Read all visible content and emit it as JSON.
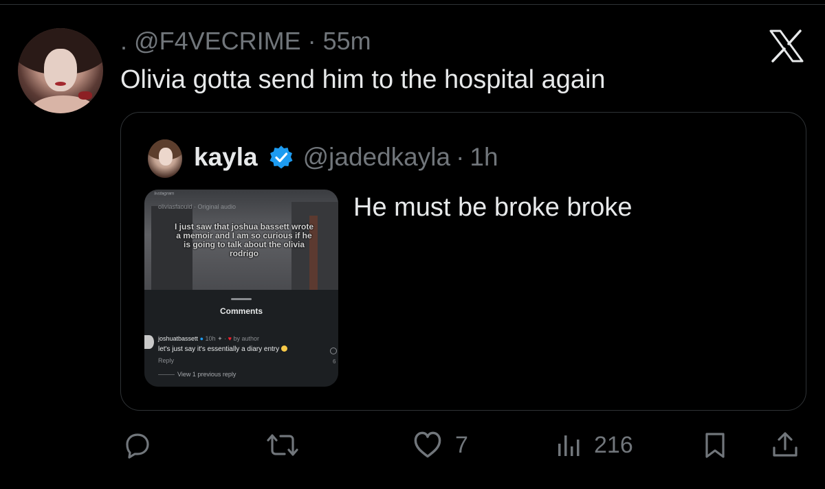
{
  "tweet": {
    "display_name": ".",
    "handle": "@F4VECRIME",
    "separator": "·",
    "time": "55m",
    "text": "Olivia gotta send him to the hospital again"
  },
  "quoted": {
    "name": "kayla",
    "handle": "@jadedkayla",
    "separator": "·",
    "time": "1h",
    "text": "He must be broke broke",
    "media": {
      "header_line": "ᴵⁿˢᵗᵃᵍʳᵃᵐ",
      "sub_header": "oliviasfaouid · Original audio",
      "overlay_text": "I just saw that joshua bassett wrote a memoir and I am so curious if he is going to talk about the olivia rodrigo",
      "comments_title": "Comments",
      "comment_user": "joshuatbassett",
      "comment_meta": "10h",
      "comment_by": "by author",
      "comment_text": "let's just say it's essentially a diary entry",
      "comment_reply": "Reply",
      "view_previous": "View 1 previous reply",
      "like_count": "6"
    }
  },
  "actions": {
    "like_count": "7",
    "views_count": "216"
  },
  "icons": {
    "reply": "reply-icon",
    "retweet": "retweet-icon",
    "like": "heart-icon",
    "views": "views-icon",
    "bookmark": "bookmark-icon",
    "share": "share-icon",
    "brand": "x-logo-icon",
    "verified": "verified-badge-icon"
  },
  "colors": {
    "background": "#000000",
    "text": "#e7e9ea",
    "muted": "#71767b",
    "border": "#2f3336",
    "verified": "#1d9bf0"
  }
}
